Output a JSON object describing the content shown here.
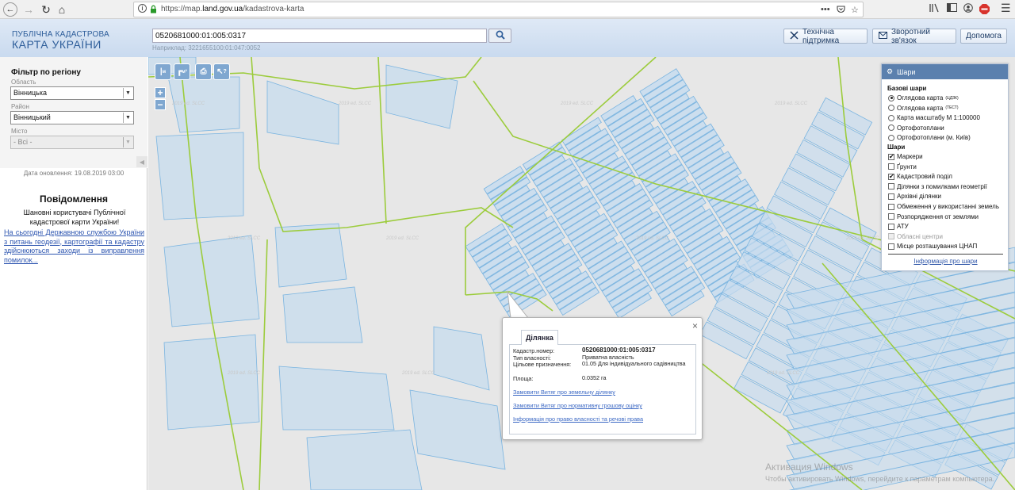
{
  "browser": {
    "url_prefix": "https://map.",
    "url_domain": "land.gov.ua",
    "url_path": "/kadastrova-karta",
    "menu_dots": "•••"
  },
  "header": {
    "logo_line1": "ПУБЛІЧНА КАДАСТРОВА",
    "logo_line2": "КАРТА УКРАЇНИ",
    "search_value": "0520681000:01:005:0317",
    "search_example": "Наприклад: 3221655100:01:047:0052",
    "buttons": {
      "support": "Технічна підтримка",
      "feedback": "Зворотний зв'язок",
      "help": "Допомога"
    }
  },
  "filter": {
    "title": "Фільтр по регіону",
    "oblast_label": "Область",
    "oblast_value": "Вінницька",
    "rayon_label": "Район",
    "rayon_value": "Вінницький",
    "city_label": "Місто",
    "city_value": "- Всі -"
  },
  "sidebar": {
    "update_date": "Дата оновлення: 19.08.2019 03:00",
    "notice_title": "Повідомлення",
    "notice_text": "Шановні користувачі Публічної кадастрової карти України!",
    "notice_link": "На сьогодні Державною службою України з питань геодезії, картографії та кадастру здійснюються заходи із виправлення помилок..."
  },
  "map_tools": {
    "zoom_in": "+",
    "zoom_out": "−",
    "watermark_text": "2019 ed. SLCC"
  },
  "layers": {
    "title": "Шари",
    "base_title": "Базові шари",
    "base": [
      {
        "label": "Оглядова карта",
        "sup": "(ЦДЗК)",
        "selected": true
      },
      {
        "label": "Оглядова карта",
        "sup": "(ТЕСТ)",
        "selected": false
      },
      {
        "label": "Карта масштабу М 1:100000",
        "sup": "",
        "selected": false
      },
      {
        "label": "Ортофотоплани",
        "sup": "",
        "selected": false
      },
      {
        "label": "Ортофотоплани (м. Київ)",
        "sup": "",
        "selected": false
      }
    ],
    "layers_title": "Шари",
    "items": [
      {
        "label": "Маркери",
        "checked": true,
        "disabled": false
      },
      {
        "label": "Ґрунти",
        "checked": false,
        "disabled": false
      },
      {
        "label": "Кадастровий поділ",
        "checked": true,
        "disabled": false
      },
      {
        "label": "Ділянки з помилками геометрії",
        "checked": false,
        "disabled": false
      },
      {
        "label": "Архівні ділянки",
        "checked": false,
        "disabled": false
      },
      {
        "label": "Обмеження у використанні земель",
        "checked": false,
        "disabled": false
      },
      {
        "label": "Розпорядження от землями",
        "checked": false,
        "disabled": false
      },
      {
        "label": "АТУ",
        "checked": false,
        "disabled": false
      },
      {
        "label": "Обласні центри",
        "checked": false,
        "disabled": true
      },
      {
        "label": "Місце розташування ЦНАП",
        "checked": false,
        "disabled": false
      }
    ],
    "info_link": "Інформація про шари"
  },
  "popup": {
    "tab": "Ділянка",
    "close": "×",
    "rows": [
      {
        "key": "Кадастр.номер:",
        "value": "0520681000:01:005:0317"
      },
      {
        "key": "Тип власності:",
        "value": "Приватна власність"
      },
      {
        "key": "Цільове призначення:",
        "value": "01.05 Для індивідуального садівництва"
      },
      {
        "key": "Площа:",
        "value": "0.0352 га"
      }
    ],
    "links": [
      "Замовити Витяг про земельну ділянку",
      "Замовити Витяг про нормативну грошову оцінку",
      "Інформація про право власності та речові права"
    ]
  },
  "os_watermark": {
    "line1": "Активация Windows",
    "line2": "Чтобы активировать Windows, перейдите к параметрам компьютера."
  },
  "colors": {
    "parcel_fill": "#c7dcee",
    "parcel_stroke": "#7ab4e0",
    "boundary": "#9ccc3c",
    "header_text": "#2e5e9a",
    "panel_header": "#5b80ae"
  }
}
